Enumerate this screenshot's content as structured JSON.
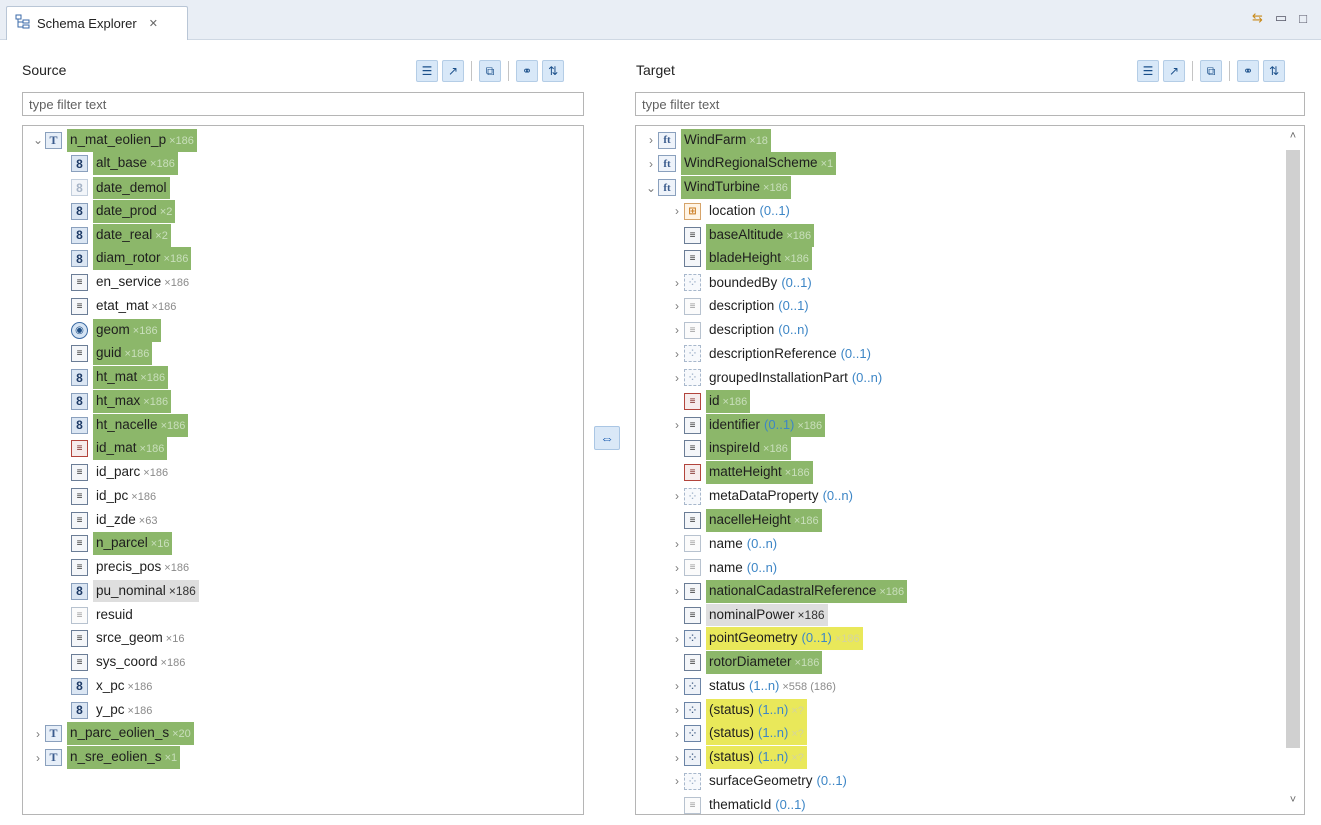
{
  "view": {
    "tab_label": "Schema Explorer",
    "tab_close": "✕",
    "tools": [
      "⇆",
      "▭",
      "□"
    ]
  },
  "source": {
    "title": "Source",
    "filter_placeholder": "type filter text",
    "toolbar": [
      "☰",
      "↗",
      "⧉",
      "⚭",
      "⇅"
    ],
    "rows": [
      {
        "depth": 0,
        "chevron": "⌄",
        "icon": "T",
        "icon_style": "type-T",
        "label": "n_mat_eolien_p",
        "count": "×186",
        "hl": "green",
        "count_style": "card"
      },
      {
        "depth": 1,
        "chevron": "",
        "icon": "8",
        "icon_style": "num8",
        "label": "alt_base",
        "count": "×186",
        "hl": "green",
        "count_style": "card"
      },
      {
        "depth": 1,
        "chevron": "",
        "icon": "8",
        "icon_style": "num8-light",
        "label": "date_demol",
        "count": "",
        "hl": "green",
        "count_style": "card"
      },
      {
        "depth": 1,
        "chevron": "",
        "icon": "8",
        "icon_style": "num8",
        "label": "date_prod",
        "count": "×2",
        "hl": "green",
        "count_style": "card"
      },
      {
        "depth": 1,
        "chevron": "",
        "icon": "8",
        "icon_style": "num8",
        "label": "date_real",
        "count": "×2",
        "hl": "green",
        "count_style": "card"
      },
      {
        "depth": 1,
        "chevron": "",
        "icon": "8",
        "icon_style": "num8",
        "label": "diam_rotor",
        "count": "×186",
        "hl": "green",
        "count_style": "card"
      },
      {
        "depth": 1,
        "chevron": "",
        "icon": "≡",
        "icon_style": "lines",
        "label": "en_service",
        "count": "×186",
        "hl": "",
        "count_style": "card-plain"
      },
      {
        "depth": 1,
        "chevron": "",
        "icon": "≡",
        "icon_style": "lines",
        "label": "etat_mat",
        "count": "×186",
        "hl": "",
        "count_style": "card-plain"
      },
      {
        "depth": 1,
        "chevron": "",
        "icon": "◉",
        "icon_style": "geom",
        "label": "geom",
        "count": "×186",
        "hl": "green",
        "count_style": "card"
      },
      {
        "depth": 1,
        "chevron": "",
        "icon": "≡",
        "icon_style": "lines",
        "label": "guid",
        "count": "×186",
        "hl": "green",
        "count_style": "card"
      },
      {
        "depth": 1,
        "chevron": "",
        "icon": "8",
        "icon_style": "num8",
        "label": "ht_mat",
        "count": "×186",
        "hl": "green",
        "count_style": "card"
      },
      {
        "depth": 1,
        "chevron": "",
        "icon": "8",
        "icon_style": "num8",
        "label": "ht_max",
        "count": "×186",
        "hl": "green",
        "count_style": "card"
      },
      {
        "depth": 1,
        "chevron": "",
        "icon": "8",
        "icon_style": "num8",
        "label": "ht_nacelle",
        "count": "×186",
        "hl": "green",
        "count_style": "card"
      },
      {
        "depth": 1,
        "chevron": "",
        "icon": "≡",
        "icon_style": "id-ico",
        "label": "id_mat",
        "count": "×186",
        "hl": "green",
        "count_style": "card"
      },
      {
        "depth": 1,
        "chevron": "",
        "icon": "≡",
        "icon_style": "lines",
        "label": "id_parc",
        "count": "×186",
        "hl": "",
        "count_style": "card-plain"
      },
      {
        "depth": 1,
        "chevron": "",
        "icon": "≡",
        "icon_style": "lines",
        "label": "id_pc",
        "count": "×186",
        "hl": "",
        "count_style": "card-plain"
      },
      {
        "depth": 1,
        "chevron": "",
        "icon": "≡",
        "icon_style": "lines",
        "label": "id_zde",
        "count": "×63",
        "hl": "",
        "count_style": "card-plain"
      },
      {
        "depth": 1,
        "chevron": "",
        "icon": "≡",
        "icon_style": "lines",
        "label": "n_parcel",
        "count": "×16",
        "hl": "green",
        "count_style": "card"
      },
      {
        "depth": 1,
        "chevron": "",
        "icon": "≡",
        "icon_style": "lines",
        "label": "precis_pos",
        "count": "×186",
        "hl": "",
        "count_style": "card-plain"
      },
      {
        "depth": 1,
        "chevron": "",
        "icon": "8",
        "icon_style": "num8",
        "label": "pu_nominal",
        "count": "×186",
        "hl": "grey",
        "count_style": "card-plain-dark"
      },
      {
        "depth": 1,
        "chevron": "",
        "icon": "≡",
        "icon_style": "lines-light",
        "label": "resuid",
        "count": "",
        "hl": "",
        "count_style": "card-plain"
      },
      {
        "depth": 1,
        "chevron": "",
        "icon": "≡",
        "icon_style": "lines",
        "label": "srce_geom",
        "count": "×16",
        "hl": "",
        "count_style": "card-plain"
      },
      {
        "depth": 1,
        "chevron": "",
        "icon": "≡",
        "icon_style": "lines",
        "label": "sys_coord",
        "count": "×186",
        "hl": "",
        "count_style": "card-plain"
      },
      {
        "depth": 1,
        "chevron": "",
        "icon": "8",
        "icon_style": "num8",
        "label": "x_pc",
        "count": "×186",
        "hl": "",
        "count_style": "card-plain"
      },
      {
        "depth": 1,
        "chevron": "",
        "icon": "8",
        "icon_style": "num8",
        "label": "y_pc",
        "count": "×186",
        "hl": "",
        "count_style": "card-plain"
      },
      {
        "depth": 0,
        "chevron": "›",
        "icon": "T",
        "icon_style": "type-T",
        "label": "n_parc_eolien_s",
        "count": "×20",
        "hl": "green",
        "count_style": "card"
      },
      {
        "depth": 0,
        "chevron": "›",
        "icon": "T",
        "icon_style": "type-T",
        "label": "n_sre_eolien_s",
        "count": "×1",
        "hl": "green",
        "count_style": "card"
      }
    ]
  },
  "middle": {
    "icon": "⇔"
  },
  "target": {
    "title": "Target",
    "filter_placeholder": "type filter text",
    "toolbar": [
      "☰",
      "↗",
      "⧉",
      "⚭",
      "⇅"
    ],
    "scroll_up": "˄",
    "scroll_down": "˅",
    "rows": [
      {
        "depth": 0,
        "chevron": "›",
        "icon": "ft",
        "icon_style": "type-ft",
        "label": "WindFarm",
        "mult": "",
        "count": "×18",
        "hl": "green",
        "count_style": "card"
      },
      {
        "depth": 0,
        "chevron": "›",
        "icon": "ft",
        "icon_style": "type-ft",
        "label": "WindRegionalScheme",
        "mult": "",
        "count": "×1",
        "hl": "green",
        "count_style": "card"
      },
      {
        "depth": 0,
        "chevron": "⌄",
        "icon": "ft",
        "icon_style": "type-ft",
        "label": "WindTurbine",
        "mult": "",
        "count": "×186",
        "hl": "green",
        "count_style": "card"
      },
      {
        "depth": 1,
        "chevron": "›",
        "icon": "⊞",
        "icon_style": "loc",
        "label": "location",
        "mult": "(0..1)",
        "count": "",
        "hl": "",
        "count_style": "card-plain"
      },
      {
        "depth": 1,
        "chevron": "",
        "icon": "≡",
        "icon_style": "lines",
        "label": "baseAltitude",
        "mult": "",
        "count": "×186",
        "hl": "green",
        "count_style": "card"
      },
      {
        "depth": 1,
        "chevron": "",
        "icon": "≡",
        "icon_style": "lines",
        "label": "bladeHeight",
        "mult": "",
        "count": "×186",
        "hl": "green",
        "count_style": "card"
      },
      {
        "depth": 1,
        "chevron": "›",
        "icon": "⁘",
        "icon_style": "grid",
        "label": "boundedBy",
        "mult": "(0..1)",
        "count": "",
        "hl": "",
        "count_style": "card-plain"
      },
      {
        "depth": 1,
        "chevron": "›",
        "icon": "≡",
        "icon_style": "lines-light",
        "label": "description",
        "mult": "(0..1)",
        "count": "",
        "hl": "",
        "count_style": "card-plain"
      },
      {
        "depth": 1,
        "chevron": "›",
        "icon": "≡",
        "icon_style": "lines-light",
        "label": "description",
        "mult": "(0..n)",
        "count": "",
        "hl": "",
        "count_style": "card-plain"
      },
      {
        "depth": 1,
        "chevron": "›",
        "icon": "⁘",
        "icon_style": "grid",
        "label": "descriptionReference",
        "mult": "(0..1)",
        "count": "",
        "hl": "",
        "count_style": "card-plain"
      },
      {
        "depth": 1,
        "chevron": "›",
        "icon": "⁘",
        "icon_style": "grid",
        "label": "groupedInstallationPart",
        "mult": "(0..n)",
        "count": "",
        "hl": "",
        "count_style": "card-plain"
      },
      {
        "depth": 1,
        "chevron": "",
        "icon": "≡",
        "icon_style": "id-ico",
        "label": "id",
        "mult": "",
        "count": "×186",
        "hl": "green",
        "count_style": "card"
      },
      {
        "depth": 1,
        "chevron": "›",
        "icon": "≡",
        "icon_style": "lines",
        "label": "identifier",
        "mult": "(0..1)",
        "count": "×186",
        "hl": "green",
        "count_style": "card"
      },
      {
        "depth": 1,
        "chevron": "",
        "icon": "≡",
        "icon_style": "lines",
        "label": "inspireId",
        "mult": "",
        "count": "×186",
        "hl": "green",
        "count_style": "card"
      },
      {
        "depth": 1,
        "chevron": "",
        "icon": "≡",
        "icon_style": "id-ico",
        "label": "matteHeight",
        "mult": "",
        "count": "×186",
        "hl": "green",
        "count_style": "card"
      },
      {
        "depth": 1,
        "chevron": "›",
        "icon": "⁘",
        "icon_style": "grid",
        "label": "metaDataProperty",
        "mult": "(0..n)",
        "count": "",
        "hl": "",
        "count_style": "card-plain"
      },
      {
        "depth": 1,
        "chevron": "",
        "icon": "≡",
        "icon_style": "lines",
        "label": "nacelleHeight",
        "mult": "",
        "count": "×186",
        "hl": "green",
        "count_style": "card"
      },
      {
        "depth": 1,
        "chevron": "›",
        "icon": "≡",
        "icon_style": "lines-light",
        "label": "name",
        "mult": "(0..n)",
        "count": "",
        "hl": "",
        "count_style": "card-plain"
      },
      {
        "depth": 1,
        "chevron": "›",
        "icon": "≡",
        "icon_style": "lines-light",
        "label": "name",
        "mult": "(0..n)",
        "count": "",
        "hl": "",
        "count_style": "card-plain"
      },
      {
        "depth": 1,
        "chevron": "›",
        "icon": "≡",
        "icon_style": "lines",
        "label": "nationalCadastralReference",
        "mult": "",
        "count": "×186",
        "hl": "green",
        "count_style": "card"
      },
      {
        "depth": 1,
        "chevron": "",
        "icon": "≡",
        "icon_style": "lines",
        "label": "nominalPower",
        "mult": "",
        "count": "×186",
        "hl": "grey",
        "count_style": "card-plain-dark"
      },
      {
        "depth": 1,
        "chevron": "›",
        "icon": "⁘",
        "icon_style": "grid-dark",
        "label": "pointGeometry",
        "mult": "(0..1)",
        "count": "×186",
        "hl": "yellow",
        "count_style": "card-yellow"
      },
      {
        "depth": 1,
        "chevron": "",
        "icon": "≡",
        "icon_style": "lines",
        "label": "rotorDiameter",
        "mult": "",
        "count": "×186",
        "hl": "green",
        "count_style": "card"
      },
      {
        "depth": 1,
        "chevron": "›",
        "icon": "⁘",
        "icon_style": "grid-dark",
        "label": "status",
        "mult": "(1..n)",
        "count": "×558 (186)",
        "hl": "",
        "count_style": "card-plain"
      },
      {
        "depth": 1,
        "chevron": "›",
        "icon": "⁘",
        "icon_style": "grid-dark",
        "label": "(status)",
        "mult": "(1..n)",
        "count": "×?",
        "hl": "yellow",
        "count_style": "card-yellow"
      },
      {
        "depth": 1,
        "chevron": "›",
        "icon": "⁘",
        "icon_style": "grid-dark",
        "label": "(status)",
        "mult": "(1..n)",
        "count": "×?",
        "hl": "yellow",
        "count_style": "card-yellow"
      },
      {
        "depth": 1,
        "chevron": "›",
        "icon": "⁘",
        "icon_style": "grid-dark",
        "label": "(status)",
        "mult": "(1..n)",
        "count": "×?",
        "hl": "yellow",
        "count_style": "card-yellow"
      },
      {
        "depth": 1,
        "chevron": "›",
        "icon": "⁘",
        "icon_style": "grid",
        "label": "surfaceGeometry",
        "mult": "(0..1)",
        "count": "",
        "hl": "",
        "count_style": "card-plain"
      },
      {
        "depth": 1,
        "chevron": "",
        "icon": "≡",
        "icon_style": "lines-light",
        "label": "thematicId",
        "mult": "(0..1)",
        "count": "",
        "hl": "",
        "count_style": "card-plain"
      }
    ]
  }
}
